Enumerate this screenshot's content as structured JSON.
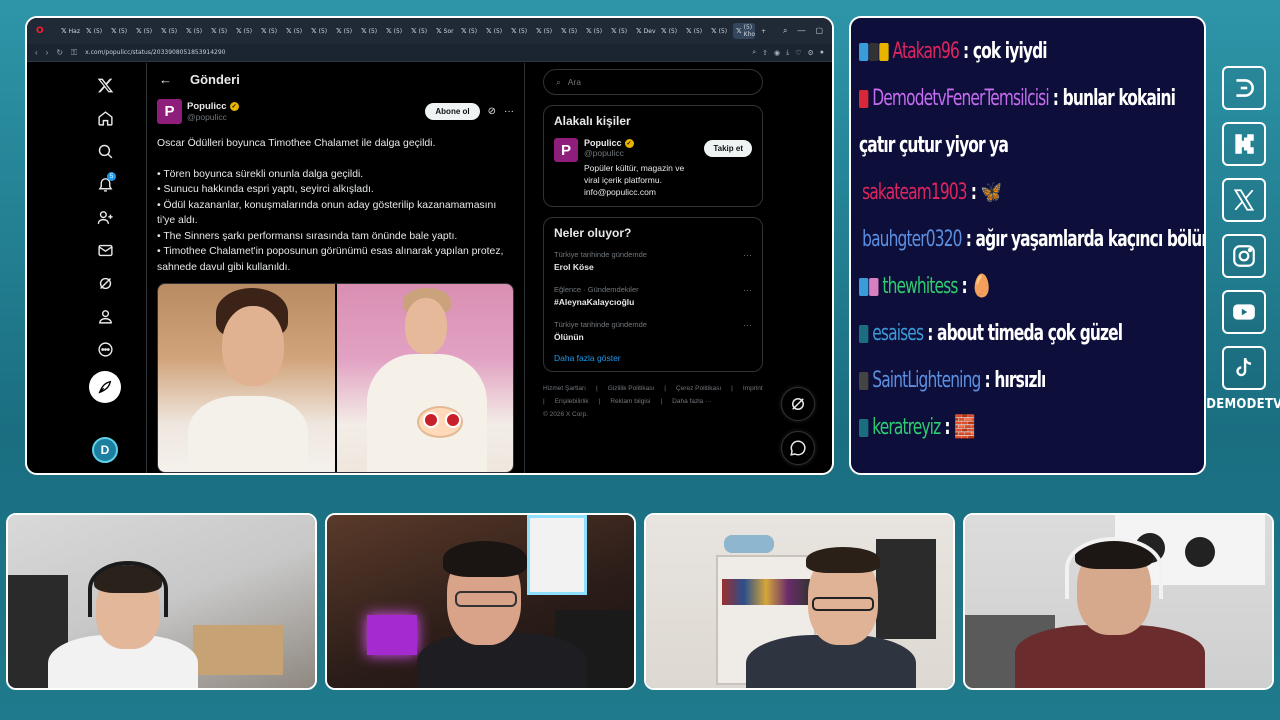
{
  "browser": {
    "tabs": [
      {
        "label": "Haz",
        "active": false
      },
      {
        "label": "(5)",
        "active": false
      },
      {
        "label": "(5)",
        "active": false
      },
      {
        "label": "(5)",
        "active": false
      },
      {
        "label": "(5)",
        "active": false
      },
      {
        "label": "(5)",
        "active": false
      },
      {
        "label": "(5)",
        "active": false
      },
      {
        "label": "(5)",
        "active": false
      },
      {
        "label": "(5)",
        "active": false
      },
      {
        "label": "(5)",
        "active": false
      },
      {
        "label": "(5)",
        "active": false
      },
      {
        "label": "(5)",
        "active": false
      },
      {
        "label": "(5)",
        "active": false
      },
      {
        "label": "(5)",
        "active": false
      },
      {
        "label": "(5)",
        "active": false
      },
      {
        "label": "Sor",
        "active": false
      },
      {
        "label": "(5)",
        "active": false
      },
      {
        "label": "(5)",
        "active": false
      },
      {
        "label": "(5)",
        "active": false
      },
      {
        "label": "(5)",
        "active": false
      },
      {
        "label": "(5)",
        "active": false
      },
      {
        "label": "(5)",
        "active": false
      },
      {
        "label": "(5)",
        "active": false
      },
      {
        "label": "Dev",
        "active": false
      },
      {
        "label": "(5)",
        "active": false
      },
      {
        "label": "(5)",
        "active": false
      },
      {
        "label": "(5)",
        "active": false
      },
      {
        "label": "(5) Kho",
        "active": true
      }
    ],
    "url": "x.com/populicc/status/2033908051853914290"
  },
  "x": {
    "header_title": "Gönderi",
    "notification_count": "5",
    "author": {
      "name": "Populicc",
      "handle": "@populicc",
      "avatar_letter": "P",
      "subscribe_label": "Abone ol"
    },
    "tweet_lines": [
      "Oscar Ödülleri boyunca Timothee Chalamet ile dalga geçildi.",
      "",
      "• Tören boyunca sürekli onunla dalga geçildi.",
      "• Sunucu hakkında espri yaptı, seyirci alkışladı.",
      "• Ödül kazananlar, konuşmalarında onun aday gösterilip kazanamamasını ti'ye aldı.",
      "• The Sinners şarkı performansı sırasında tam önünde bale yaptı.",
      "• Timothee Chalamet'in poposunun görünümü esas alınarak yapılan protez, sahnede davul gibi kullanıldı."
    ],
    "search_placeholder": "Ara",
    "related": {
      "title": "Alakalı kişiler",
      "name": "Populicc",
      "handle": "@populicc",
      "avatar_letter": "P",
      "bio": "Popüler kültür, magazin ve viral içerik platformu. info@populicc.com",
      "follow_label": "Takip et"
    },
    "trends": {
      "title": "Neler oluyor?",
      "items": [
        {
          "context": "Türkiye tarihinde gündemde",
          "topic": "Erol Köse"
        },
        {
          "context": "Eğlence · Gündemdekiler",
          "topic": "#AleynaKalaycıoğlu"
        },
        {
          "context": "Türkiye tarihinde gündemde",
          "topic": "Ölünün"
        }
      ],
      "show_more": "Daha fazla göster"
    },
    "footer": [
      "Hizmet Şartları",
      "|",
      "Gizlilik Politikası",
      "|",
      "Çerez Politikası",
      "|",
      "Imprint",
      "|",
      "Erişilebilirlik",
      "|",
      "Reklam bilgisi",
      "|",
      "Daha fazla ···",
      "© 2026 X Corp."
    ]
  },
  "chat": {
    "messages": [
      {
        "user": "Atakan96",
        "color": "#e0245e",
        "text": ": çok iyiydi",
        "emotes": [
          "#3b9bd8",
          "#333333",
          "#e8b400"
        ]
      },
      {
        "user": "DemodetvFenerTemsilcisi",
        "color": "#c56cf0",
        "text": ": bunlar kokaini çatır çutur yiyor ya",
        "emotes": [
          "#d62839"
        ],
        "wrap": true
      },
      {
        "user": "sakateam1903",
        "color": "#e0245e",
        "text": ": 🦋",
        "emotes": []
      },
      {
        "user": "bauhgter0320",
        "color": "#5b8fe0",
        "text": ": ağır yaşamlarda kaçıncı bölümde",
        "emotes": []
      },
      {
        "user": "thewhitess",
        "color": "#2ecc71",
        "text": ": 🥚",
        "emotes": [
          "#3b9bd8",
          "#d77fc0"
        ]
      },
      {
        "user": "esaises",
        "color": "#3b9bd8",
        "text": ": about timeda çok güzel",
        "emotes": [
          "#1a6e80"
        ]
      },
      {
        "user": "SaintLightening",
        "color": "#5b8fe0",
        "text": ": hırsızlı",
        "emotes": [
          "#444444"
        ]
      },
      {
        "user": "keratreyiz",
        "color": "#2ecc71",
        "text": ": 🧱",
        "emotes": [
          "#1a6e80"
        ]
      }
    ]
  },
  "socials": {
    "items": [
      "demode-icon",
      "kick-icon",
      "x-icon",
      "instagram-icon",
      "youtube-icon",
      "tiktok-icon"
    ],
    "brand": "DEMODETV"
  },
  "colors": {
    "accent_blue": "#1d9bf0",
    "background_teal": "#2e95a8",
    "chat_bg": "#0e0e3a",
    "populicc_purple": "#8e1d7c"
  }
}
